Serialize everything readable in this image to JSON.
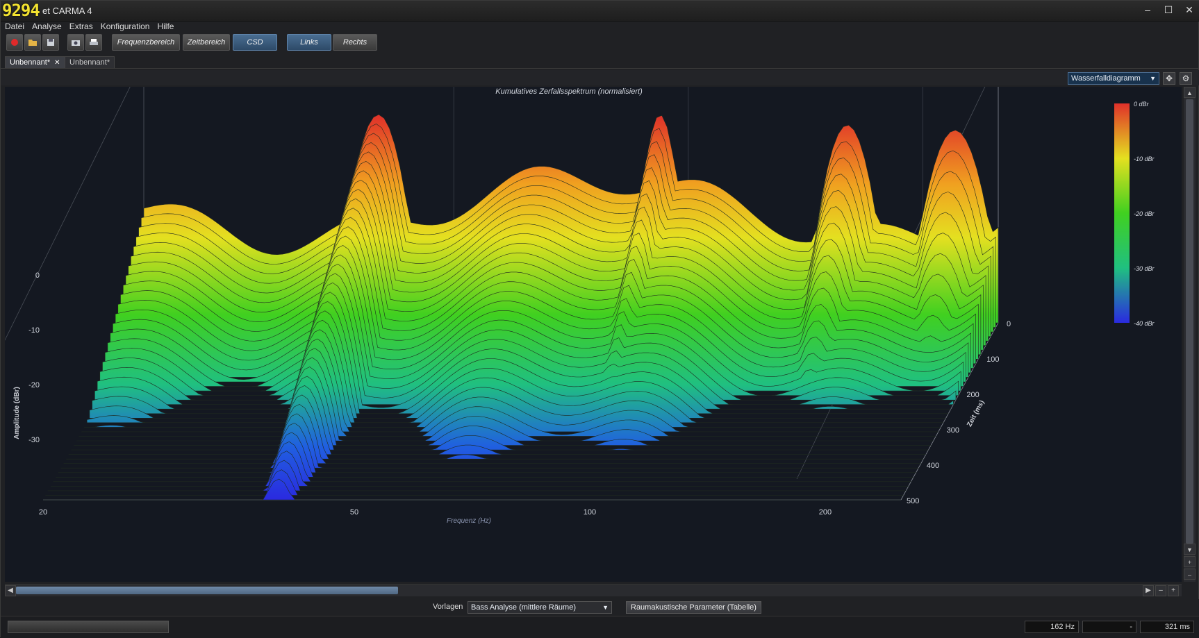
{
  "window": {
    "fps_counter": "9294",
    "title": "et CARMA 4",
    "controls": {
      "minimize": "–",
      "maximize": "☐",
      "close": "✕"
    }
  },
  "menu": [
    "Datei",
    "Analyse",
    "Extras",
    "Konfiguration",
    "Hilfe"
  ],
  "toolbar": {
    "buttons": [
      "Frequenzbereich",
      "Zeitbereich",
      "CSD",
      "Links",
      "Rechts"
    ],
    "active": [
      "CSD",
      "Links"
    ]
  },
  "tabs": [
    {
      "label": "Unbennant*",
      "active": true,
      "closable": true
    },
    {
      "label": "Unbennant*",
      "active": false,
      "closable": false
    }
  ],
  "view_select": {
    "value": "Wasserfalldiagramm"
  },
  "chart_data": {
    "type": "area",
    "title": "Kumulatives Zerfallsspektrum (normalisiert)",
    "xlabel": "Frequenz (Hz)",
    "ylabel": "Amplitude (dBr)",
    "zlabel": "Zeit (ms)",
    "x_ticks": [
      "20",
      "50",
      "100",
      "200"
    ],
    "y_ticks": [
      "0",
      "-10",
      "-20",
      "-30"
    ],
    "z_ticks": [
      "0",
      "100",
      "200",
      "300",
      "400",
      "500"
    ],
    "colorbar": {
      "labels": [
        "0 dBr",
        "-10 dBr",
        "-20 dBr",
        "-30 dBr",
        "-40 dBr"
      ],
      "colors": [
        "#e0302a",
        "#f0a020",
        "#e4e020",
        "#40d020",
        "#20c080",
        "#2060e0",
        "#2a2ae0"
      ]
    },
    "xlim": [
      20,
      250
    ],
    "ylim": [
      -40,
      0
    ],
    "zlim": [
      0,
      500
    ],
    "peaks_hz": [
      40,
      92,
      160,
      220
    ],
    "slices": 40
  },
  "bottom": {
    "presets_label": "Vorlagen",
    "presets_value": "Bass Analyse (mittlere Räume)",
    "table_button": "Raumakustische Parameter (Tabelle)"
  },
  "status": {
    "freq": "162 Hz",
    "mid": "-",
    "time": "321 ms"
  }
}
